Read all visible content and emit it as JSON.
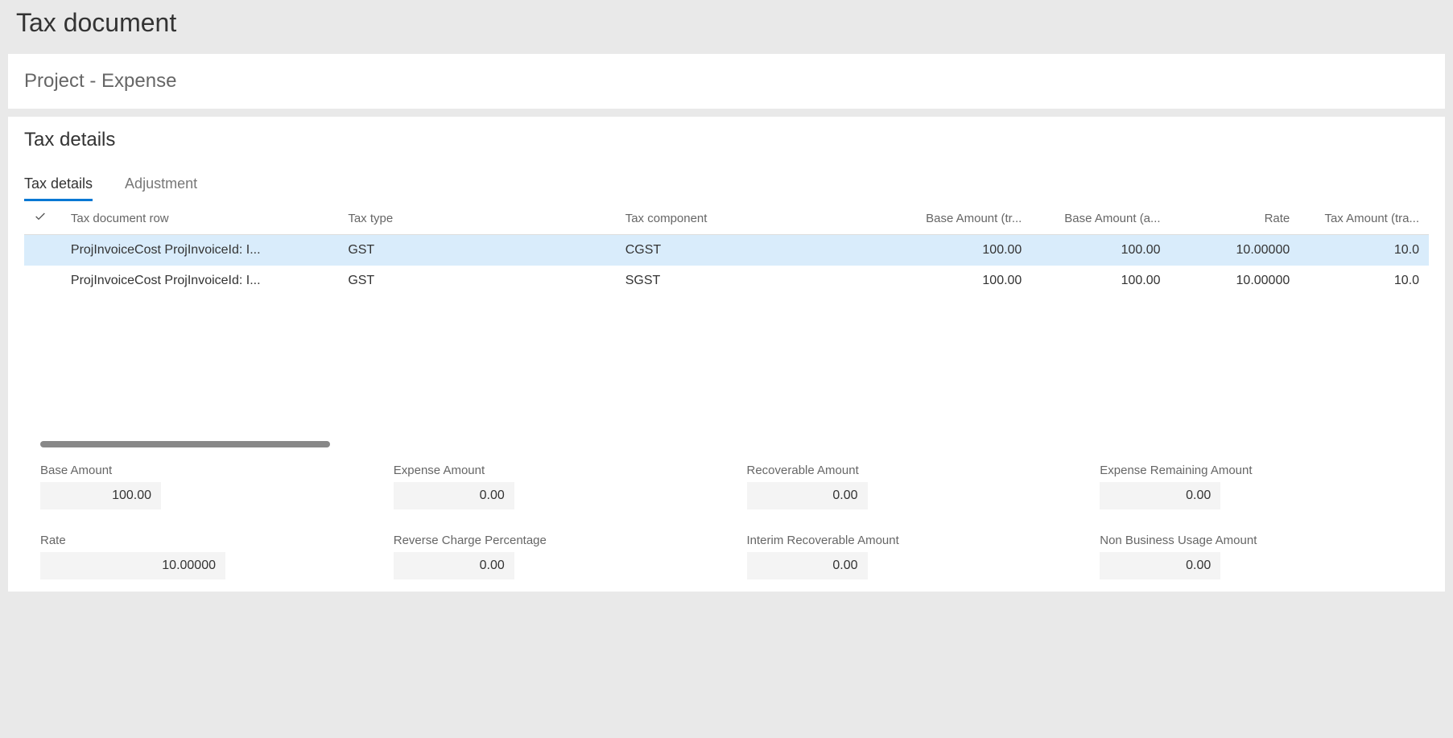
{
  "page": {
    "title": "Tax document",
    "subtitle": "Project - Expense",
    "section_title": "Tax details"
  },
  "tabs": [
    {
      "label": "Tax details",
      "active": true
    },
    {
      "label": "Adjustment",
      "active": false
    }
  ],
  "columns": {
    "tax_document_row": "Tax document row",
    "tax_type": "Tax type",
    "tax_component": "Tax component",
    "base_amount_tr": "Base Amount (tr...",
    "base_amount_a": "Base Amount (a...",
    "rate": "Rate",
    "tax_amount_tr": "Tax Amount (tra..."
  },
  "rows": [
    {
      "tax_document_row": "ProjInvoiceCost ProjInvoiceId: I...",
      "tax_type": "GST",
      "tax_component": "CGST",
      "base_amount_tr": "100.00",
      "base_amount_a": "100.00",
      "rate": "10.00000",
      "tax_amount_tr": "10.0",
      "selected": true
    },
    {
      "tax_document_row": "ProjInvoiceCost ProjInvoiceId: I...",
      "tax_type": "GST",
      "tax_component": "SGST",
      "base_amount_tr": "100.00",
      "base_amount_a": "100.00",
      "rate": "10.00000",
      "tax_amount_tr": "10.0",
      "selected": false
    }
  ],
  "detail_fields": {
    "base_amount": {
      "label": "Base Amount",
      "value": "100.00"
    },
    "expense_amount": {
      "label": "Expense Amount",
      "value": "0.00"
    },
    "recoverable_amount": {
      "label": "Recoverable Amount",
      "value": "0.00"
    },
    "expense_remaining_amount": {
      "label": "Expense Remaining Amount",
      "value": "0.00"
    },
    "rate": {
      "label": "Rate",
      "value": "10.00000"
    },
    "reverse_charge_percentage": {
      "label": "Reverse Charge Percentage",
      "value": "0.00"
    },
    "interim_recoverable_amount": {
      "label": "Interim Recoverable Amount",
      "value": "0.00"
    },
    "non_business_usage_amount": {
      "label": "Non Business Usage Amount",
      "value": "0.00"
    }
  }
}
